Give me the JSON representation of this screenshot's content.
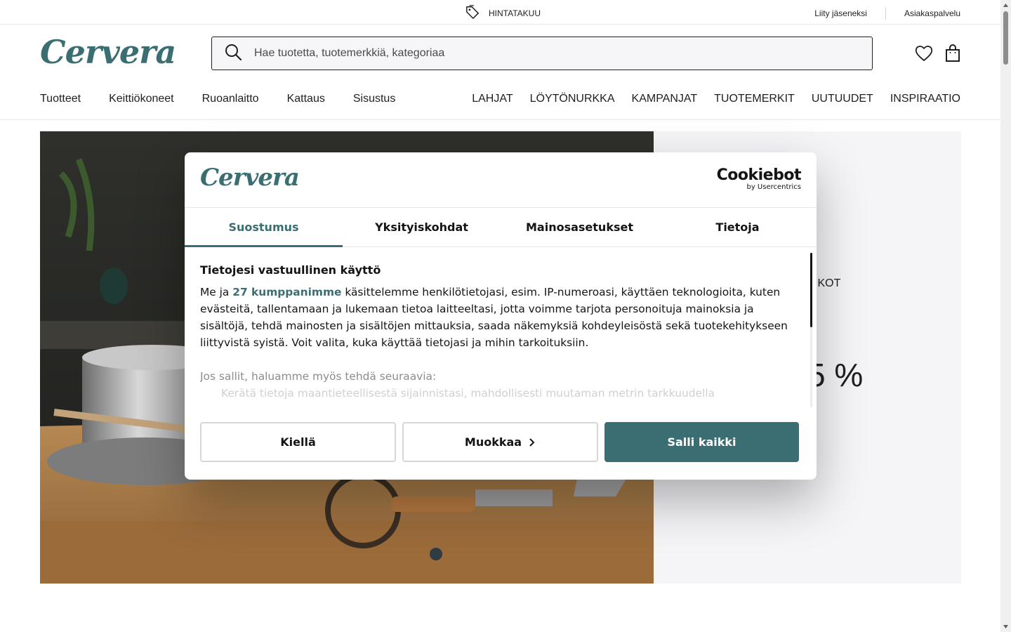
{
  "topbar": {
    "promo_label": "HINTATAKUU",
    "links": [
      "Liity jäseneksi",
      "Asiakaspalvelu"
    ]
  },
  "header": {
    "logo": "Cervera",
    "search_placeholder": "Hae tuotetta, tuotemerkkiä, kategoriaa",
    "icons": [
      "heart-icon",
      "shopping-bag-icon"
    ]
  },
  "nav": {
    "left": [
      "Tuotteet",
      "Keittiökoneet",
      "Ruoanlaitto",
      "Kattaus",
      "Sisustus"
    ],
    "right": [
      "LAHJAT",
      "LÖYTÖNURKKA",
      "KAMPANJAT",
      "TUOTEMERKIT",
      "UUTUUDET",
      "INSPIRAATIO"
    ]
  },
  "hero": {
    "side_text_1": "IKOT",
    "side_text_2": "5 %"
  },
  "cookie_dialog": {
    "logo": "Cervera",
    "provider_name": "Cookiebot",
    "provider_sub": "by Usercentrics",
    "tabs": [
      "Suostumus",
      "Yksityiskohdat",
      "Mainosasetukset",
      "Tietoja"
    ],
    "active_tab": "Suostumus",
    "heading": "Tietojesi vastuullinen käyttö",
    "body_prefix": "Me ja ",
    "partners_link": "27 kumppanimme",
    "body_suffix": " käsittelemme henkilötietojasi, esim. IP-numeroasi, käyttäen teknologioita, kuten evästeitä, tallentamaan ja lukemaan tietoa laitteeltasi, jotta voimme tarjota personoituja mainoksia ja sisältöjä, tehdä mainosten ja sisältöjen mittauksia, saada näkemyksiä kohdeyleisöstä sekä tuotekehitykseen liittyvistä syistä. Voit valita, kuka käyttää tietojasi ja mihin tarkoituksiin.",
    "more_intro": "Jos sallit, haluamme myös tehdä seuraavia:",
    "more_item": "Kerätä tietoja maantieteellisestä sijainnistasi, mahdollisesti muutaman metrin tarkkuudella",
    "buttons": {
      "deny": "Kiellä",
      "customize": "Muokkaa",
      "allow_all": "Salli kaikki"
    }
  }
}
